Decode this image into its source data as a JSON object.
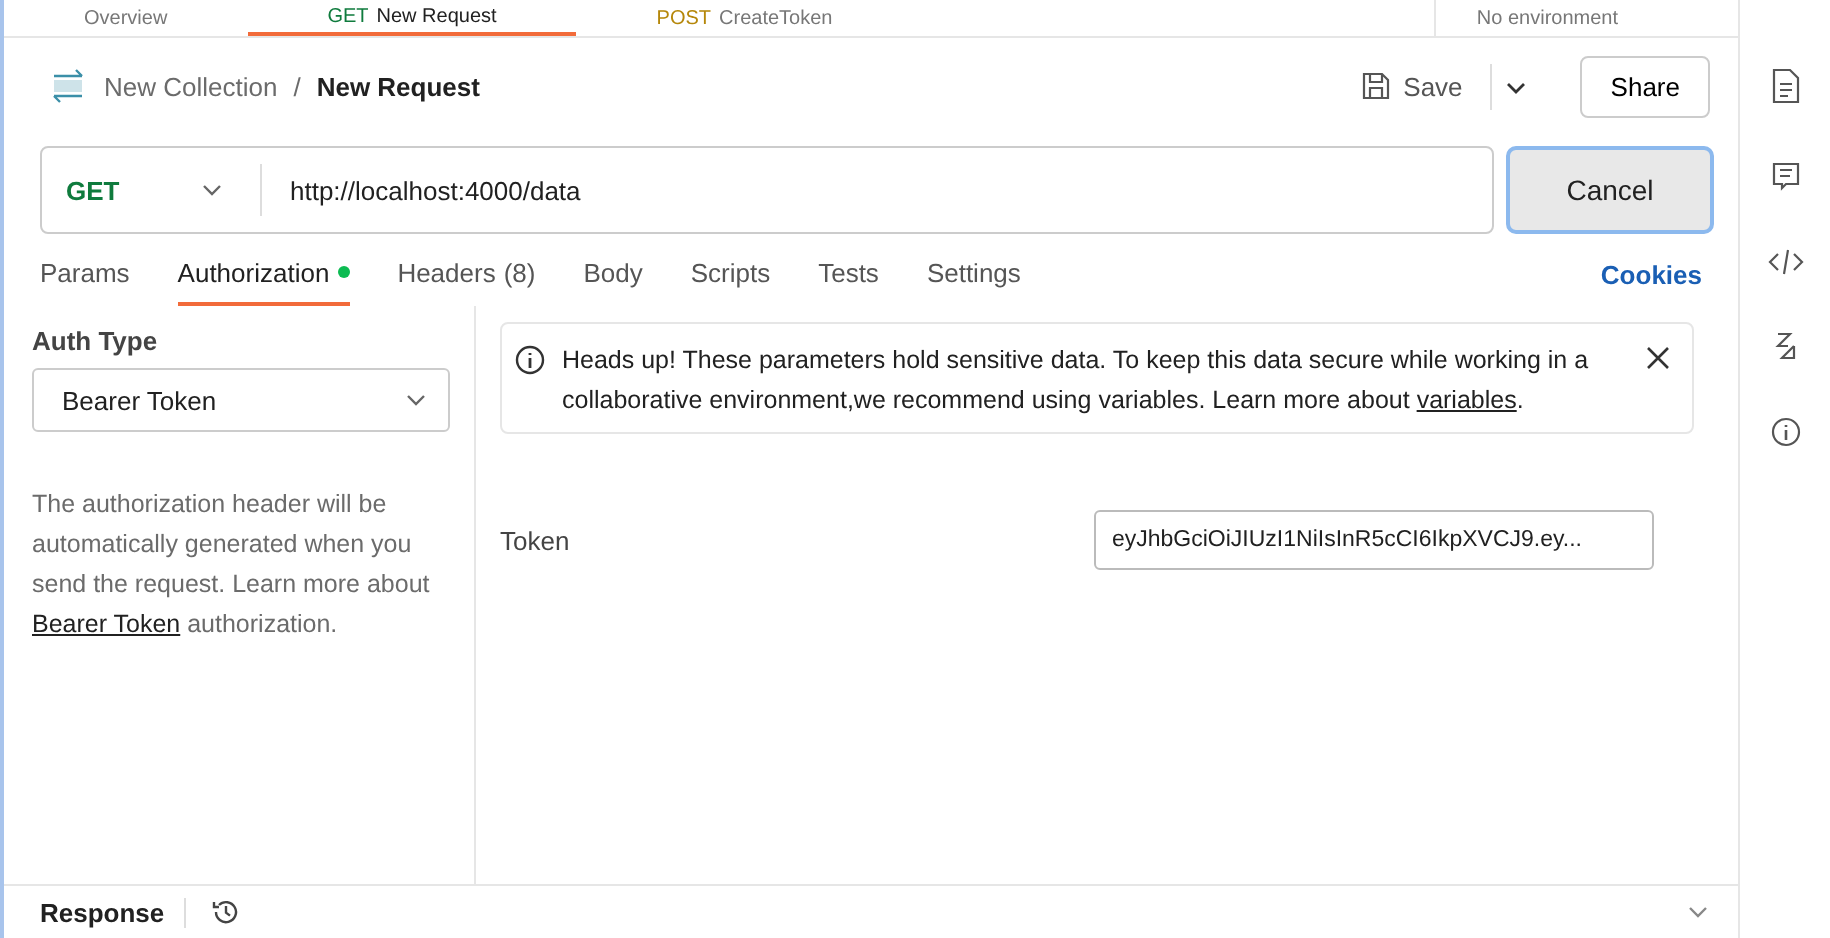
{
  "top_tabs": [
    {
      "label": "Overview",
      "selected": false
    },
    {
      "method": "GET",
      "label": "New Request",
      "selected": true
    },
    {
      "method": "POST",
      "label": "CreateToken",
      "selected": false
    }
  ],
  "environment": "No environment",
  "breadcrumb": {
    "collection": "New Collection",
    "separator": "/",
    "request": "New Request"
  },
  "actions": {
    "save": "Save",
    "share": "Share"
  },
  "request": {
    "method": "GET",
    "url": "http://localhost:4000/data",
    "send": "Cancel"
  },
  "tabs": [
    {
      "label": "Params",
      "selected": false,
      "dot": false
    },
    {
      "label": "Authorization",
      "selected": true,
      "dot": true
    },
    {
      "label": "Headers",
      "count": "(8)",
      "selected": false,
      "dot": false
    },
    {
      "label": "Body",
      "selected": false,
      "dot": false
    },
    {
      "label": "Scripts",
      "selected": false,
      "dot": false
    },
    {
      "label": "Tests",
      "selected": false,
      "dot": false
    },
    {
      "label": "Settings",
      "selected": false,
      "dot": false
    }
  ],
  "cookies": "Cookies",
  "auth": {
    "label": "Auth Type",
    "type": "Bearer Token",
    "help_before": "The authorization header will be automatically generated when you send the request. Learn more about",
    "help_link": "Bearer Token",
    "help_after": "authorization."
  },
  "notice": {
    "text": "Heads up! These parameters hold sensitive data. To keep this data secure while working in a collaborative environment,we recommend using variables. Learn more about",
    "link": "variables",
    "after": "."
  },
  "token": {
    "label": "Token",
    "value": "eyJhbGciOiJIUzI1NiIsInR5cCI6IkpXVCJ9.ey..."
  },
  "response": {
    "label": "Response"
  }
}
